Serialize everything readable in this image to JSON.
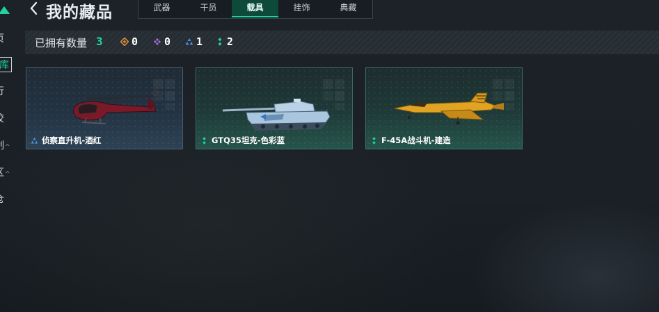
{
  "nav": {
    "items": [
      {
        "label": "页",
        "caret": ""
      },
      {
        "label": "库",
        "caret": ""
      },
      {
        "label": "行",
        "caret": ""
      },
      {
        "label": "绞",
        "caret": ""
      },
      {
        "label": "制",
        "caret": "^"
      },
      {
        "label": "区",
        "caret": "^"
      },
      {
        "label": "仓",
        "caret": ""
      }
    ]
  },
  "header": {
    "title": "我的藏品",
    "tabs": [
      {
        "label": "武器"
      },
      {
        "label": "干员"
      },
      {
        "label": "载具"
      },
      {
        "label": "挂饰"
      },
      {
        "label": "典藏"
      }
    ],
    "active_tab": "载具"
  },
  "stats": {
    "label": "已拥有数量",
    "total": "3",
    "rarities": [
      {
        "icon": "orange-diamond-icon",
        "color": "#d98b3a",
        "count": "0"
      },
      {
        "icon": "purple-diamond-icon",
        "color": "#9b6cd6",
        "count": "0"
      },
      {
        "icon": "blue-triangle-icon",
        "color": "#4e8fd6",
        "count": "1"
      },
      {
        "icon": "green-dots-icon",
        "color": "#20d49b",
        "count": "2"
      }
    ]
  },
  "cards": [
    {
      "name": "侦察直升机-酒红",
      "rarity_color": "#4e8fd6",
      "rarity_icon": "blue-triangle-icon",
      "theme": "blue"
    },
    {
      "name": "GTQ35坦克-色彩蓝",
      "rarity_color": "#20d49b",
      "rarity_icon": "green-dots-icon",
      "theme": "green"
    },
    {
      "name": "F-45A战斗机-建造",
      "rarity_color": "#20d49b",
      "rarity_icon": "green-dots-icon",
      "theme": "green"
    }
  ],
  "colors": {
    "accent": "#20d49b",
    "tab_active_bg": "#0e4a39"
  }
}
